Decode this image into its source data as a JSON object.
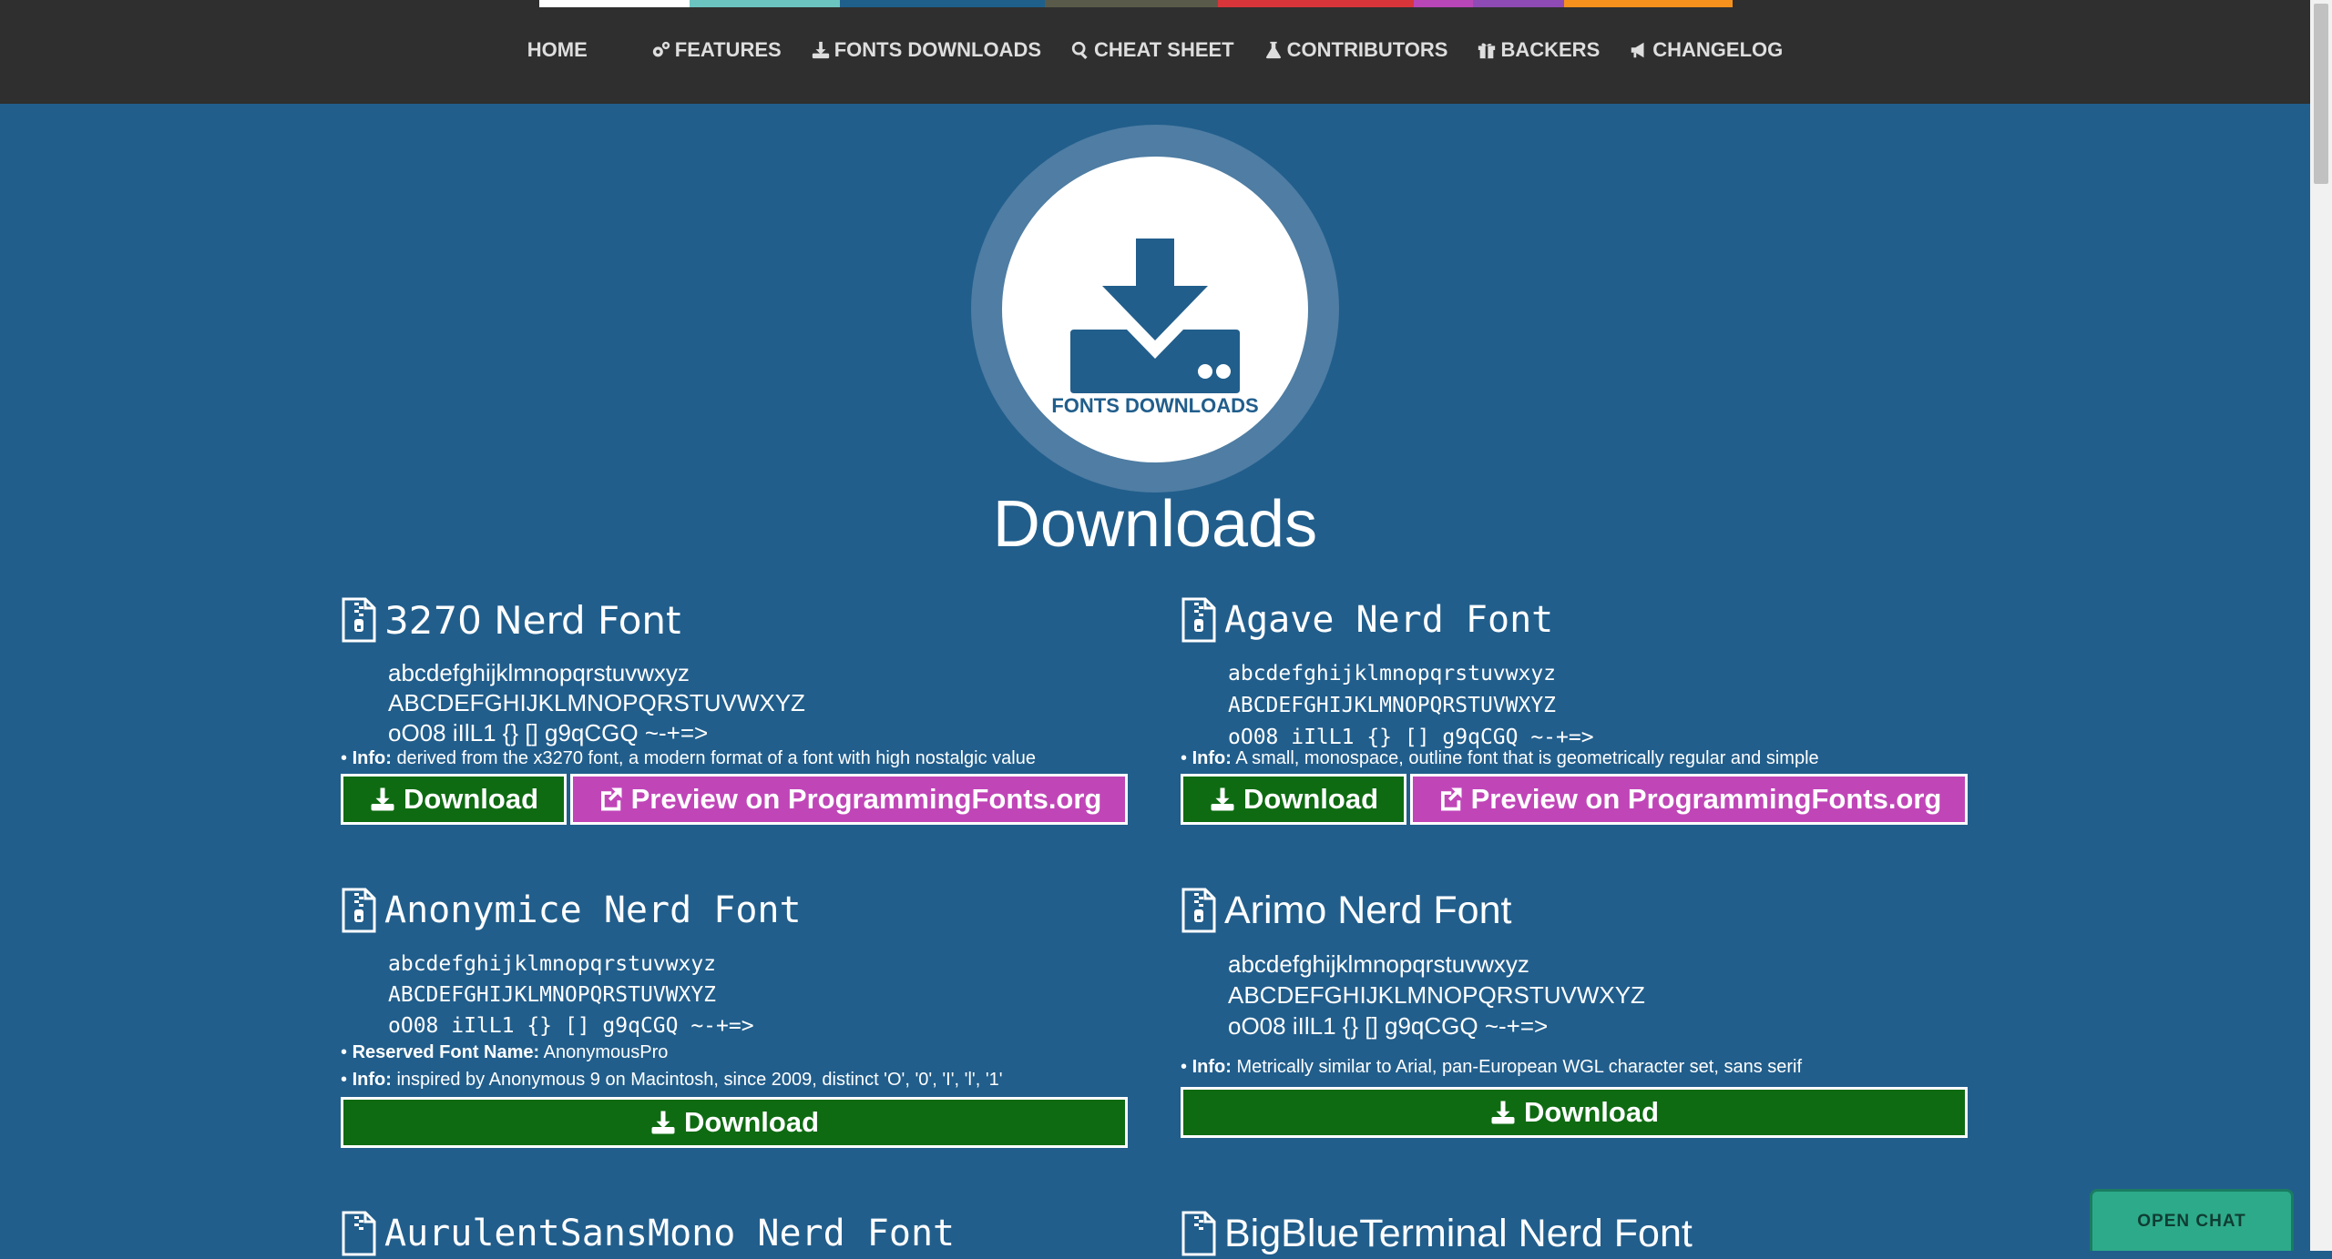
{
  "nav": {
    "items": [
      {
        "label": "HOME",
        "icon": ""
      },
      {
        "label": "FEATURES",
        "icon": "gears-icon"
      },
      {
        "label": "FONTS DOWNLOADS",
        "icon": "download-icon"
      },
      {
        "label": "CHEAT SHEET",
        "icon": "search-icon"
      },
      {
        "label": "CONTRIBUTORS",
        "icon": "flask-icon"
      },
      {
        "label": "BACKERS",
        "icon": "gift-icon"
      },
      {
        "label": "CHANGELOG",
        "icon": "bullhorn-icon"
      }
    ],
    "active": "FONTS DOWNLOADS",
    "strip_colors": [
      "#ffffff",
      "#6cc4c0",
      "#1f5f8c",
      "#5a5a4a",
      "#d8353b",
      "#b846b7",
      "#8e4ab5",
      "#f7911e"
    ]
  },
  "hero": {
    "label": "FONTS DOWNLOADS",
    "title": "Downloads"
  },
  "sample_lines": {
    "lower": "abcdefghijklmnopqrstuvwxyz",
    "upper": "ABCDEFGHIJKLMNOPQRSTUVWXYZ",
    "glyphs": "oO08 iIlL1 {} [] g9qCGQ ~-+=>"
  },
  "fonts": [
    {
      "name": "3270 Nerd Font",
      "info_label": "Info:",
      "info": "derived from the x3270 font, a modern format of a font with high nostalgic value",
      "download_label": "Download",
      "preview_label": "Preview on ProgrammingFonts.org"
    },
    {
      "name": "Agave Nerd Font",
      "info_label": "Info:",
      "info": "A small, monospace, outline font that is geometrically regular and simple",
      "download_label": "Download",
      "preview_label": "Preview on ProgrammingFonts.org"
    },
    {
      "name": "Anonymice Nerd Font",
      "reserved_label": "Reserved Font Name:",
      "reserved": "AnonymousPro",
      "info_label": "Info:",
      "info": "inspired by Anonymous 9 on Macintosh, since 2009, distinct 'O', '0', 'I', 'l', '1'",
      "download_label": "Download"
    },
    {
      "name": "Arimo Nerd Font",
      "info_label": "Info:",
      "info": "Metrically similar to Arial, pan-European WGL character set, sans serif",
      "download_label": "Download"
    },
    {
      "name": "AurulentSansMono Nerd Font"
    },
    {
      "name": "BigBlueTerminal Nerd Font"
    }
  ],
  "chat": {
    "label": "OPEN CHAT"
  },
  "colors": {
    "page_bg": "#215e8c",
    "download_btn": "#0e6b12",
    "preview_btn": "#c046b8",
    "chat_btn": "#2daa8a"
  }
}
